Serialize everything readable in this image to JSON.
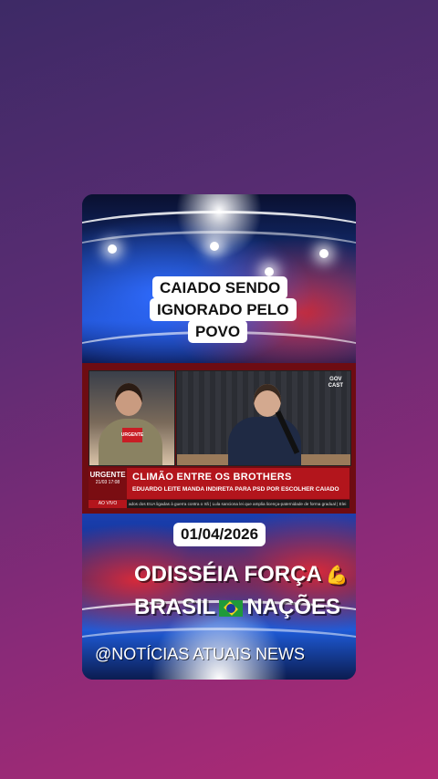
{
  "captions": [
    "CAIADO SENDO",
    "IGNORADO PELO",
    "POVO"
  ],
  "news": {
    "mic_logo": "URGENTE",
    "govcast_line1": "GOV",
    "govcast_line2": "CAST",
    "brand": "URGENTE",
    "brand_time": "21/03 17:08",
    "live_label": "AO VIVO",
    "headline": "CLIMÃO ENTRE OS BROTHERS",
    "subheadline": "EDUARDO LEITE MANDA INDIRETA PARA PSD POR ESCOLHER CAIADO",
    "ticker": "ados dos EUA ligadas à guerra contra o Irã | Lula sanciona lei que amplia licença-paternidade de forma gradual | Elei"
  },
  "date": "01/04/2026",
  "title_line1": "ODISSÉIA FORÇA",
  "title_line1_emoji": "💪",
  "title_line2_left": "BRASIL",
  "title_line2_right": "NAÇÕES",
  "handle": "@NOTÍCIAS ATUAIS NEWS"
}
